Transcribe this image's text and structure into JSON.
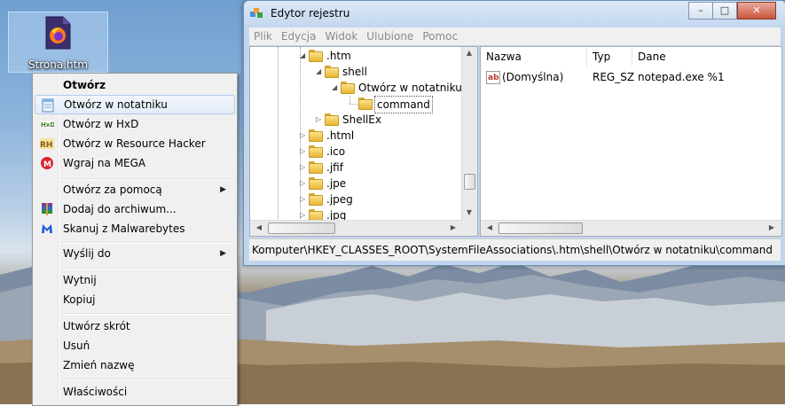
{
  "desktop": {
    "file_icon": "firefox-html-file-icon",
    "file_name": "Strona.htm"
  },
  "context_menu": {
    "items": [
      {
        "label": "Otwórz",
        "icon": "",
        "bold": true
      },
      {
        "label": "Otwórz w notatniku",
        "icon": "notepad-icon",
        "highlighted": true
      },
      {
        "label": "Otwórz w HxD",
        "icon": "hxd-icon"
      },
      {
        "label": "Otwórz w Resource Hacker",
        "icon": "resource-hacker-icon"
      },
      {
        "label": "Wgraj na MEGA",
        "icon": "mega-icon"
      },
      {
        "label": "Otwórz za pomocą",
        "submenu": true
      },
      {
        "label": "Dodaj do archiwum...",
        "icon": "winrar-icon"
      },
      {
        "label": "Skanuj z Malwarebytes",
        "icon": "malwarebytes-icon"
      },
      {
        "label": "Wyślij do",
        "submenu": true
      },
      {
        "label": "Wytnij"
      },
      {
        "label": "Kopiuj"
      },
      {
        "label": "Utwórz skrót"
      },
      {
        "label": "Usuń"
      },
      {
        "label": "Zmień nazwę"
      },
      {
        "label": "Właściwości"
      }
    ]
  },
  "regedit": {
    "title": "Edytor rejestru",
    "controls": {
      "minimize": "–",
      "maximize": "□",
      "close": "✕"
    },
    "menu": [
      "Plik",
      "Edycja",
      "Widok",
      "Ulubione",
      "Pomoc"
    ],
    "tree": [
      {
        "label": ".htm",
        "expander": "◢"
      },
      {
        "label": "shell",
        "expander": "◢"
      },
      {
        "label": "Otwórz w notatniku",
        "expander": "◢"
      },
      {
        "label": "command",
        "expander": "",
        "selected": true
      },
      {
        "label": "ShellEx",
        "expander": "▷"
      },
      {
        "label": ".html",
        "expander": "▷"
      },
      {
        "label": ".ico",
        "expander": "▷"
      },
      {
        "label": ".jfif",
        "expander": "▷"
      },
      {
        "label": ".jpe",
        "expander": "▷"
      },
      {
        "label": ".jpeg",
        "expander": "▷"
      },
      {
        "label": ".jpg",
        "expander": "▷"
      }
    ],
    "columns": [
      "Nazwa",
      "Typ",
      "Dane"
    ],
    "values": [
      {
        "name": "(Domyślna)",
        "type": "REG_SZ",
        "data": "notepad.exe %1",
        "icon": "reg-sz-ab-icon"
      }
    ],
    "status_path": "Komputer\\HKEY_CLASSES_ROOT\\SystemFileAssociations\\.htm\\shell\\Otwórz w notatniku\\command"
  }
}
